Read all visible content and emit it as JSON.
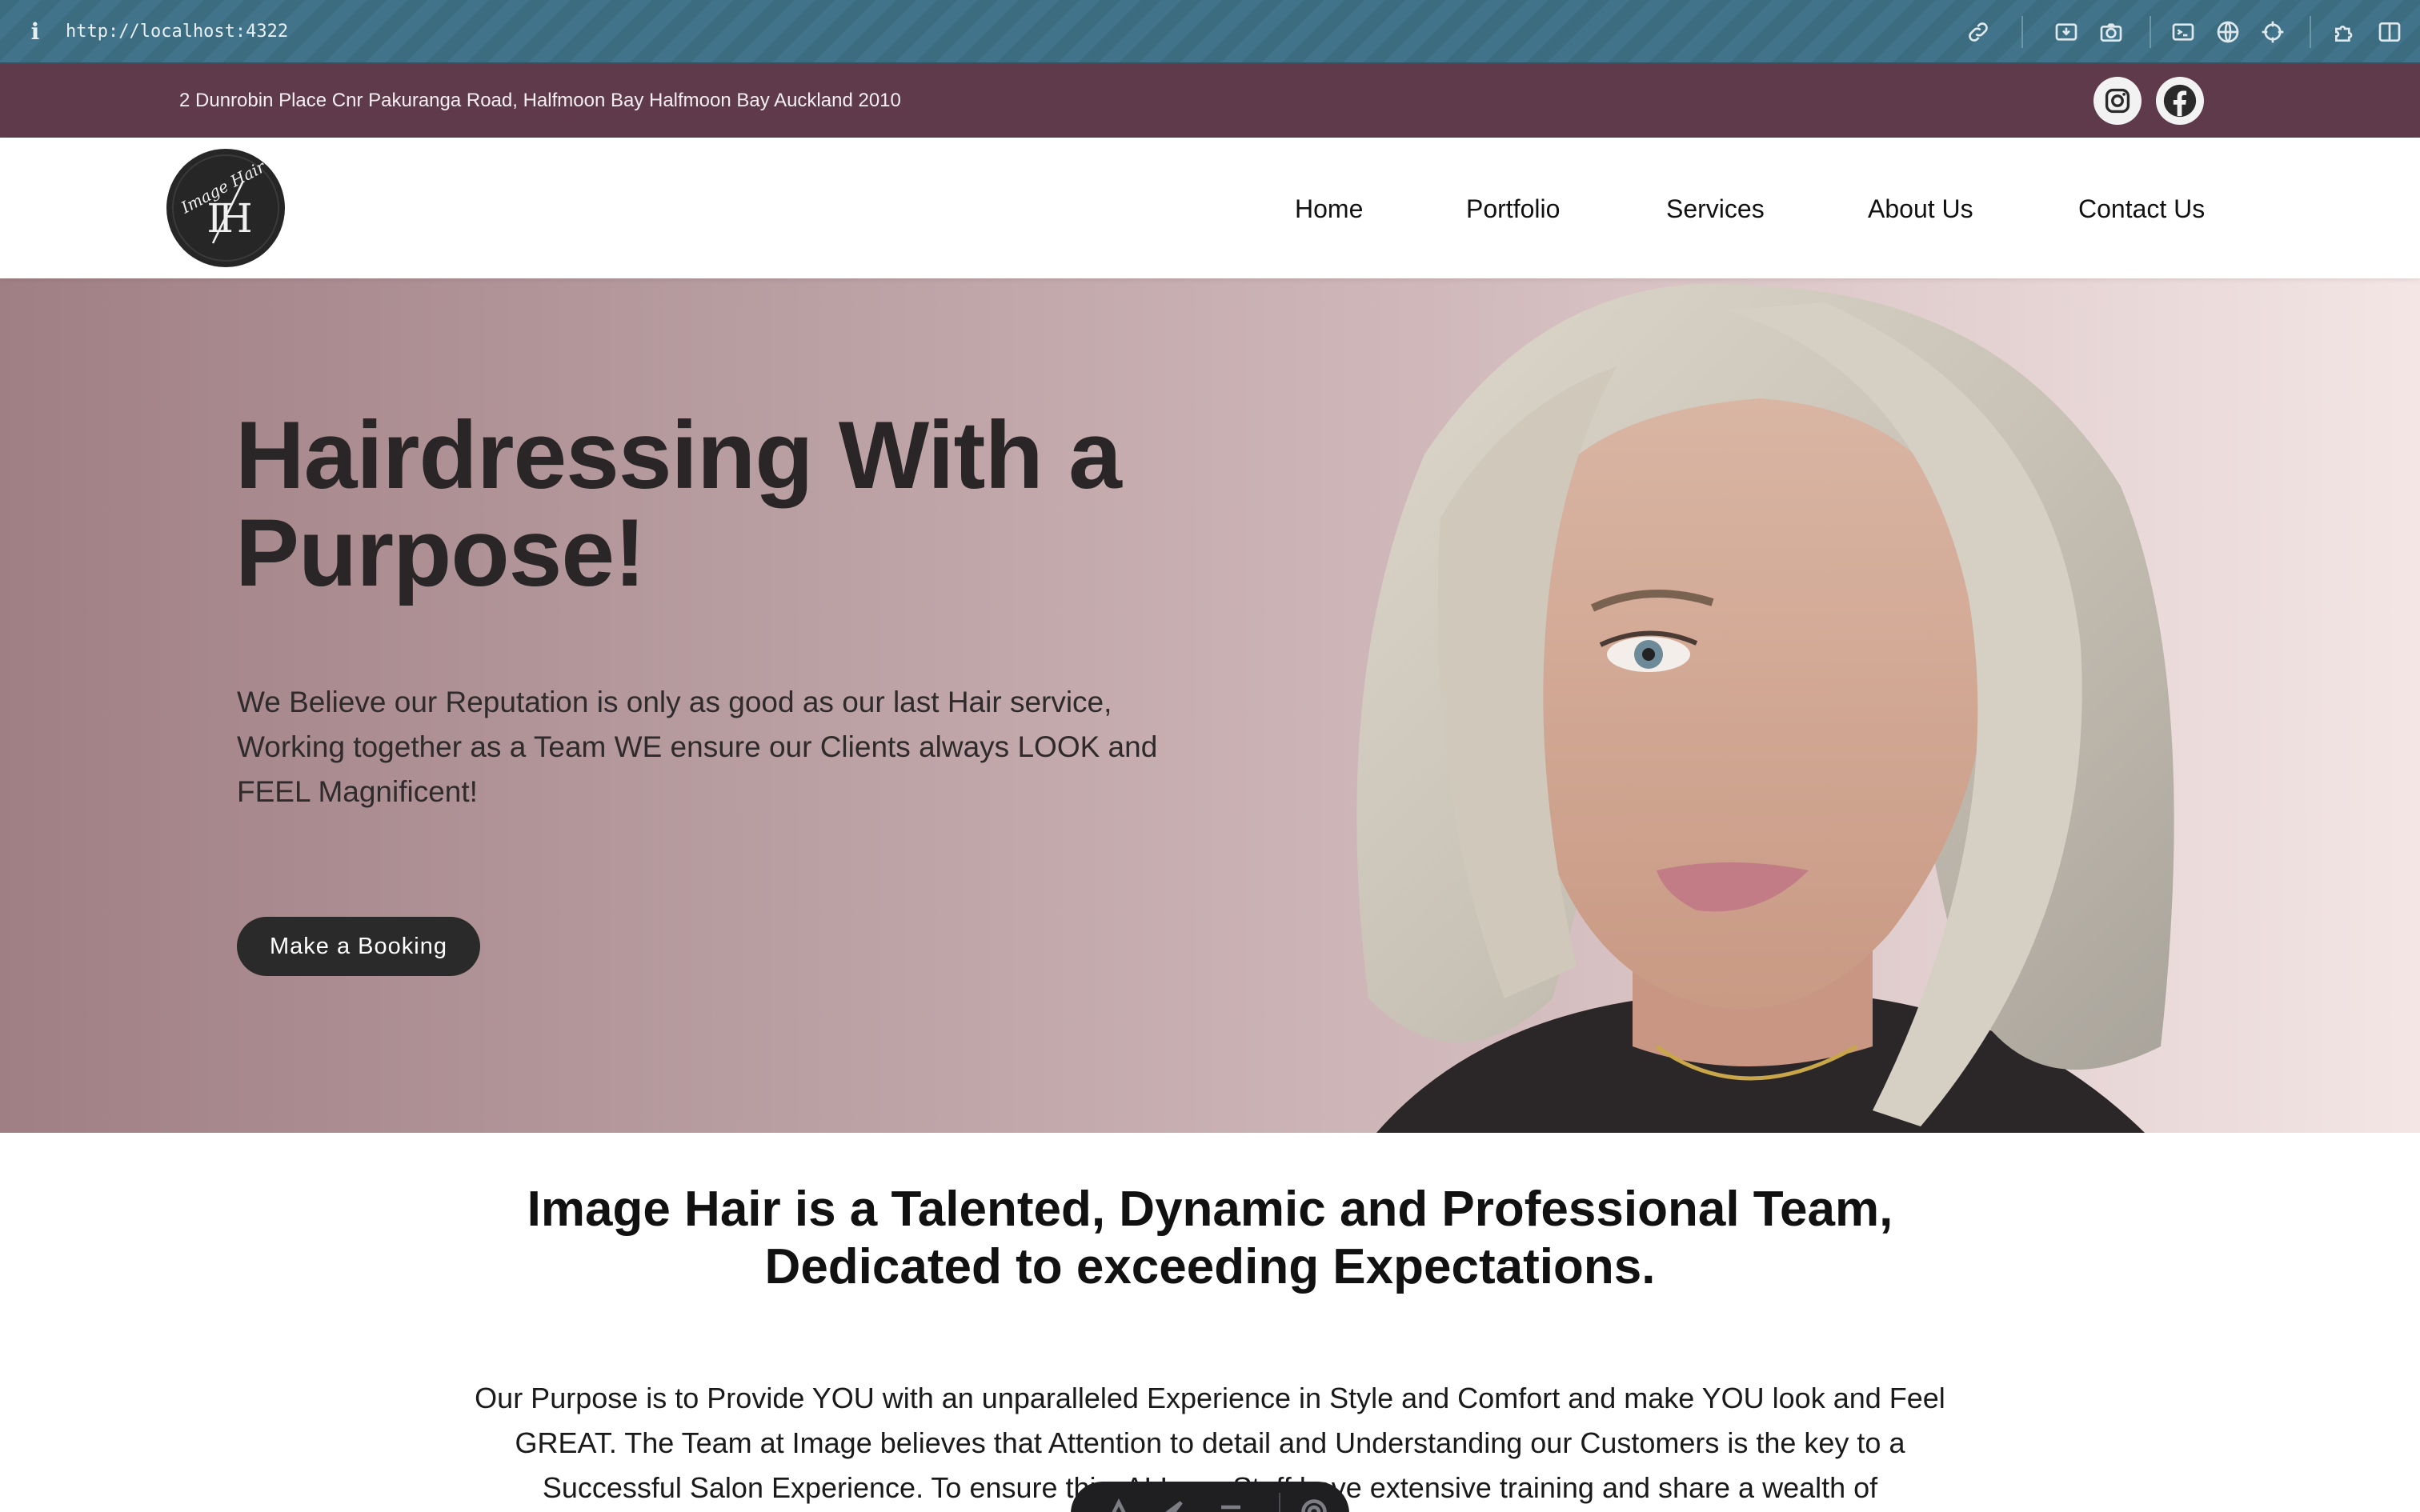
{
  "browser": {
    "url": "http://localhost:4322",
    "info_icon": "i",
    "toolbar_icons": [
      "link-icon",
      "download-icon",
      "camera-icon",
      "terminal-icon",
      "globe-icon",
      "crosshair-icon",
      "extensions-icon",
      "sidebar-icon"
    ]
  },
  "topbar": {
    "address": "2 Dunrobin Place Cnr Pakuranga Road, Halfmoon Bay Halfmoon Bay Auckland 2010",
    "social": [
      "instagram-icon",
      "facebook-icon"
    ]
  },
  "nav": {
    "logo_text": "Image Hair",
    "logo_monogram": "IH",
    "items": [
      {
        "label": "Home"
      },
      {
        "label": "Portfolio"
      },
      {
        "label": "Services"
      },
      {
        "label": "About Us"
      },
      {
        "label": "Contact Us"
      }
    ]
  },
  "hero": {
    "title": "Hairdressing With a Purpose!",
    "subtitle": "We Believe our Reputation is only as good as our last Hair service, Working together as a Team WE ensure our Clients always LOOK and FEEL Magnificent!",
    "cta": "Make a Booking"
  },
  "about": {
    "heading": "Image Hair is a Talented, Dynamic and Professional Team, Dedicated to exceeding Expectations.",
    "text": "Our Purpose is to Provide YOU with an unparalleled Experience in Style and Comfort and make YOU look and Feel GREAT. The Team at Image believes that Attention to detail and Understanding our Customers is the key to a Successful Salon Experience. To ensure this, ALL our Staff have extensive training and share a wealth of"
  },
  "colors": {
    "browser_bar": "#3b6c80",
    "info_bar": "#5e3a4a",
    "hero_left": "#a07f84",
    "hero_right": "#f3e6e5",
    "button": "#2a2a2a"
  }
}
